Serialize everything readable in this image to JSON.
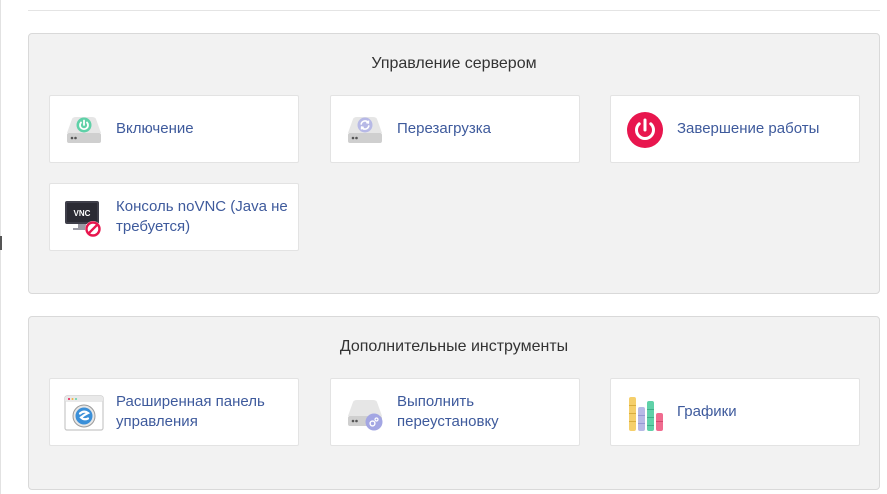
{
  "server_management": {
    "title": "Управление сервером",
    "items": [
      {
        "label": "Включение",
        "icon": "server-power-on-icon"
      },
      {
        "label": "Перезагрузка",
        "icon": "server-restart-icon"
      },
      {
        "label": "Завершение работы",
        "icon": "shutdown-icon"
      },
      {
        "label": "Консоль noVNC (Java не требуется)",
        "icon": "vnc-console-icon",
        "icon_text": "VNC"
      }
    ]
  },
  "extra_tools": {
    "title": "Дополнительные инструменты",
    "items": [
      {
        "label": "Расширенная панель управления",
        "icon": "control-panel-icon"
      },
      {
        "label": "Выполнить переустановку",
        "icon": "reinstall-icon"
      },
      {
        "label": "Графики",
        "icon": "graphs-icon"
      }
    ]
  },
  "colors": {
    "link": "#3e5a9c",
    "power_on": "#5fd1a8",
    "shutdown": "#e8164e",
    "panel_bg": "#f2f2f2"
  }
}
